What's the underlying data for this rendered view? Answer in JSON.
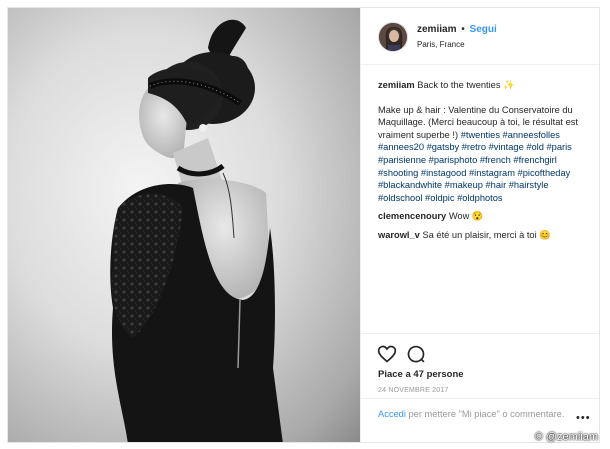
{
  "post": {
    "username": "zemiiam",
    "separator": "•",
    "follow_label": "Segui",
    "location": "Paris, France"
  },
  "caption": {
    "username": "zemiiam",
    "title": "Back to the twenties ✨",
    "body": "Make up & hair : Valentine du Conservatoire du Maquillage. (Merci beaucoup à toi, le résultat est vraiment superbe !) ",
    "hashtags": "#twenties #anneesfolles #annees20 #gatsby #retro #vintage #old #paris #parisienne #parisphoto #french #frenchgirl #shooting #instagood #instagram #picoftheday #blackandwhite #makeup #hair #hairstyle #oldschool #oldpic #oldphotos"
  },
  "comments": [
    {
      "username": "clemencenoury",
      "text": "Wow 😯"
    },
    {
      "username": "warowl_v",
      "text": "Sa été un plaisir, merci à toi 😊"
    }
  ],
  "actions": {
    "likes": "Piace a 47 persone",
    "date": "24 NOVEMBRE 2017"
  },
  "add_comment": {
    "login_link": "Accedi",
    "rest": " per mettere \"Mi piace\" o commentare.",
    "more": "•••"
  },
  "watermark": "© @zemiiam",
  "icons": {
    "avatar": "avatar-image",
    "like": "heart-icon",
    "comment": "comment-bubble-icon",
    "more": "more-options-icon"
  },
  "colors": {
    "link_blue": "#3897f0",
    "hashtag_blue": "#003569",
    "border": "#efefef",
    "muted": "#999999"
  }
}
